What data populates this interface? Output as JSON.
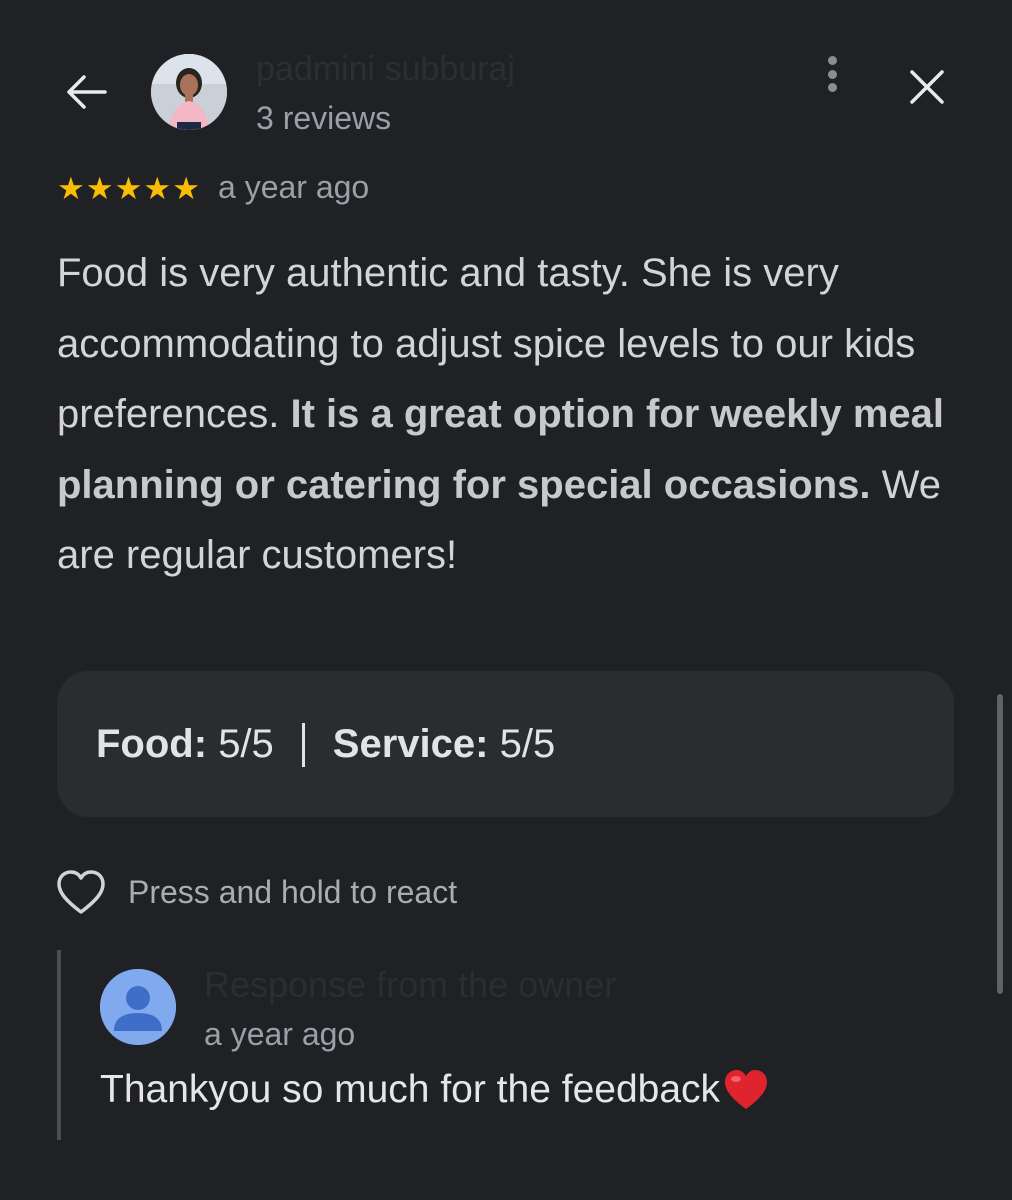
{
  "header": {
    "back_icon": "arrow-left-icon",
    "reviewer_name": "padmini subburaj",
    "review_count": "3 reviews",
    "more_icon": "more-vertical-icon",
    "close_icon": "close-icon"
  },
  "review": {
    "rating": 5,
    "max_rating": 5,
    "time": "a year ago",
    "text_segments": [
      {
        "text": "Food is very authentic and tasty. She is very accommodating to adjust spice levels to our kids preferences. ",
        "bold": false
      },
      {
        "text": "It is a great option for weekly meal planning or catering for special occasions.",
        "bold": true
      },
      {
        "text": " We are regular customers!",
        "bold": false
      }
    ]
  },
  "ratings": {
    "food_label": "Food:",
    "food_value": "5/5",
    "service_label": "Service:",
    "service_value": "5/5"
  },
  "react": {
    "icon": "heart-outline-icon",
    "hint": "Press and hold to react"
  },
  "owner_response": {
    "title": "Response from the owner",
    "time": "a year ago",
    "text": "Thankyou so much for the feedback",
    "emoji_icon": "red-heart-icon"
  },
  "colors": {
    "background": "#202124",
    "star": "#fbbc04",
    "card": "#2b2c2f",
    "owner_avatar": "#80a9ee"
  }
}
